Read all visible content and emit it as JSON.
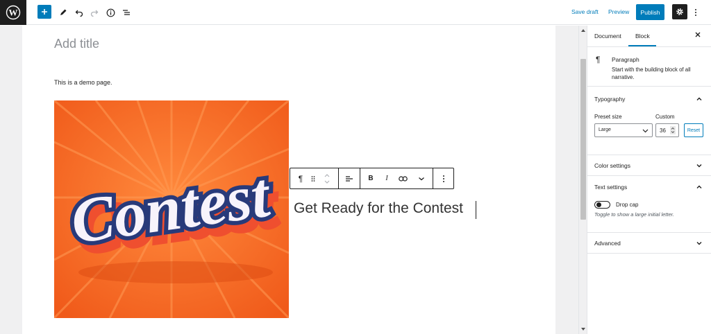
{
  "toolbar": {
    "save_draft": "Save draft",
    "preview": "Preview",
    "publish": "Publish"
  },
  "editor": {
    "title_placeholder": "Add title",
    "paragraph": "This is a demo page.",
    "image_text": "Contest",
    "heading": "Get Ready for the Contest"
  },
  "block_toolbar": {
    "paragraph_glyph": "¶",
    "bold": "B",
    "italic": "I"
  },
  "sidebar": {
    "tabs": [
      "Document",
      "Block"
    ],
    "active_tab": "Block",
    "block": {
      "name": "Paragraph",
      "description": "Start with the building block of all narrative."
    },
    "typography": {
      "title": "Typography",
      "preset_label": "Preset size",
      "preset_value": "Large",
      "custom_label": "Custom",
      "custom_value": "36",
      "reset": "Reset"
    },
    "color_settings": "Color settings",
    "text_settings": {
      "title": "Text settings",
      "drop_cap": "Drop cap",
      "drop_cap_help": "Toggle to show a large initial letter."
    },
    "advanced": "Advanced"
  },
  "colors": {
    "accent": "#007cba",
    "dark": "#1e1e1e",
    "image_orange": "#f26522",
    "image_navy": "#283a7a"
  }
}
